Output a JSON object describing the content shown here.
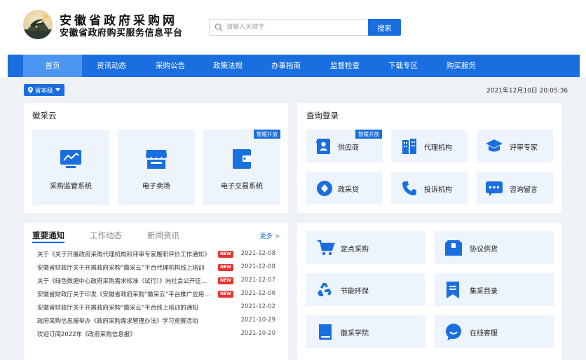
{
  "header": {
    "title_main": "安徽省政府采购网",
    "title_sub": "安徽省政府购买服务信息平台",
    "search_placeholder": "请输入关键字",
    "search_button": "搜索"
  },
  "nav": {
    "items": [
      "首页",
      "资讯动态",
      "采购公告",
      "政策法规",
      "办事指南",
      "监督检查",
      "下载专区",
      "购买服务"
    ],
    "active": "首页"
  },
  "toolbar": {
    "region": "省本级",
    "datetime": "2021年12月10日   20:05:36"
  },
  "huicaiyun": {
    "title": "徽采云",
    "tiles": [
      {
        "label": "采购监管系统",
        "icon": "monitor-chart-icon"
      },
      {
        "label": "电子卖场",
        "icon": "storefront-icon"
      },
      {
        "label": "电子交易系统",
        "icon": "wallet-icon",
        "tag": "暂缓开放"
      }
    ]
  },
  "query": {
    "title": "查询登录",
    "items": [
      {
        "label": "供应商",
        "icon": "supplier-card-icon",
        "tag": "暂缓开放"
      },
      {
        "label": "代理机构",
        "icon": "building-icon"
      },
      {
        "label": "评审专家",
        "icon": "graduation-cap-icon"
      },
      {
        "label": "政采贷",
        "icon": "diamond-coin-icon"
      },
      {
        "label": "投诉机构",
        "icon": "phone-icon"
      },
      {
        "label": "咨询留言",
        "icon": "chat-bubble-icon"
      }
    ]
  },
  "news": {
    "tabs": [
      "重要通知",
      "工作动态",
      "新闻资讯"
    ],
    "active_tab": "重要通知",
    "more": "更多 >",
    "new_badge": "NEW",
    "items": [
      {
        "title": "关于《关于开展政府采购代理机构和评审专家履职评价工作通知》",
        "date": "2021-12-08",
        "is_new": true
      },
      {
        "title": "安徽省财政厅关于开展政府采购“徽采云”平台代理机构线上培训",
        "date": "2021-12-08",
        "is_new": true
      },
      {
        "title": "关于《绿色数据中心政府采购需求标准（试行）》向社会公开征求意见",
        "date": "2021-12-07",
        "is_new": true
      },
      {
        "title": "安徽省财政厅关于印发《安徽省政府采购“徽采云”平台推广应用方案》",
        "date": "2021-12-06",
        "is_new": true
      },
      {
        "title": "安徽省财政厅关于开展政府采购“徽采云”平台线上培训的通知",
        "date": "2021-12-02",
        "is_new": false
      },
      {
        "title": "政府采购信息报举办《政府采购需求管理办法》学习竞赛活动",
        "date": "2021-10-29",
        "is_new": false
      },
      {
        "title": "欢迎订阅2022年《政府采购信息报》",
        "date": "2021-10-20",
        "is_new": false
      }
    ]
  },
  "services": {
    "items": [
      {
        "label": "定点采购",
        "icon": "shopping-cart-icon"
      },
      {
        "label": "协议供货",
        "icon": "box-icon"
      },
      {
        "label": "节能环保",
        "icon": "recycle-icon"
      },
      {
        "label": "集采目录",
        "icon": "bookmark-list-icon"
      },
      {
        "label": "徽采学院",
        "icon": "book-icon"
      },
      {
        "label": "在线客服",
        "icon": "customer-service-icon"
      }
    ]
  },
  "colors": {
    "primary": "#1a6fe0",
    "nav_active": "#4c96f2",
    "tile_bg": "#edf4fc",
    "page_bg": "#eef1f5",
    "new_badge": "#e8322b"
  }
}
